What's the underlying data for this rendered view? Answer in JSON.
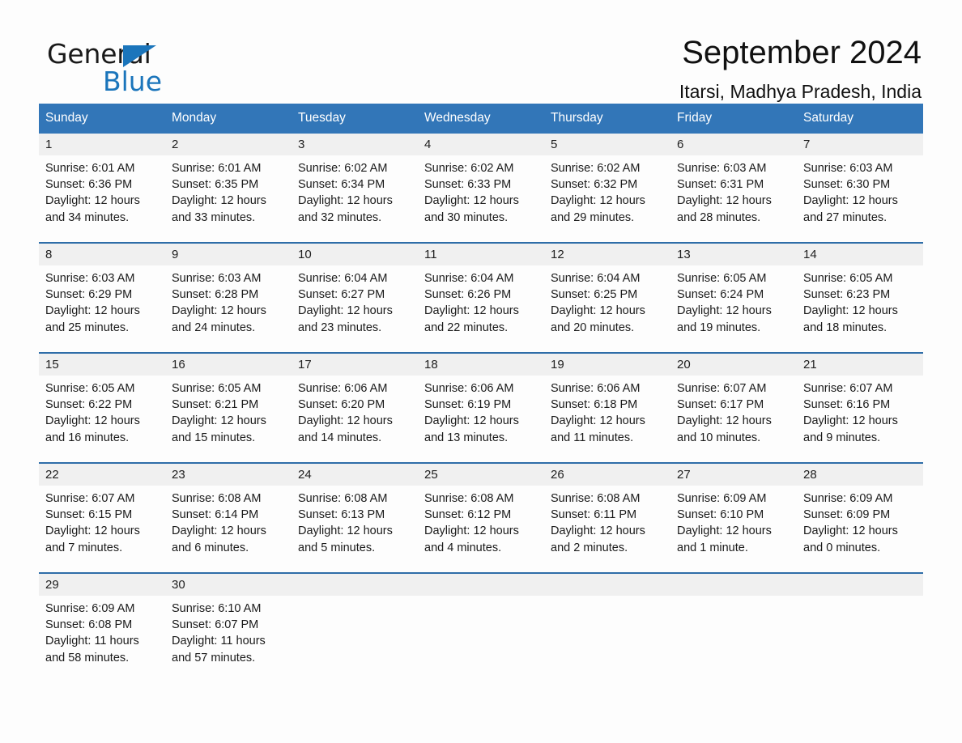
{
  "brand": {
    "word1": "General",
    "word2": "Blue",
    "triangle_color": "#1b75bb"
  },
  "header": {
    "title": "September 2024",
    "subtitle": "Itarsi, Madhya Pradesh, India"
  },
  "theme": {
    "header_blue": "#3276b8",
    "row_rule_blue": "#2e6da8",
    "day_band_gray": "#f0f0f0"
  },
  "weekdays": [
    "Sunday",
    "Monday",
    "Tuesday",
    "Wednesday",
    "Thursday",
    "Friday",
    "Saturday"
  ],
  "weeks": [
    [
      {
        "day": "1",
        "sunrise": "Sunrise: 6:01 AM",
        "sunset": "Sunset: 6:36 PM",
        "daylight1": "Daylight: 12 hours",
        "daylight2": "and 34 minutes."
      },
      {
        "day": "2",
        "sunrise": "Sunrise: 6:01 AM",
        "sunset": "Sunset: 6:35 PM",
        "daylight1": "Daylight: 12 hours",
        "daylight2": "and 33 minutes."
      },
      {
        "day": "3",
        "sunrise": "Sunrise: 6:02 AM",
        "sunset": "Sunset: 6:34 PM",
        "daylight1": "Daylight: 12 hours",
        "daylight2": "and 32 minutes."
      },
      {
        "day": "4",
        "sunrise": "Sunrise: 6:02 AM",
        "sunset": "Sunset: 6:33 PM",
        "daylight1": "Daylight: 12 hours",
        "daylight2": "and 30 minutes."
      },
      {
        "day": "5",
        "sunrise": "Sunrise: 6:02 AM",
        "sunset": "Sunset: 6:32 PM",
        "daylight1": "Daylight: 12 hours",
        "daylight2": "and 29 minutes."
      },
      {
        "day": "6",
        "sunrise": "Sunrise: 6:03 AM",
        "sunset": "Sunset: 6:31 PM",
        "daylight1": "Daylight: 12 hours",
        "daylight2": "and 28 minutes."
      },
      {
        "day": "7",
        "sunrise": "Sunrise: 6:03 AM",
        "sunset": "Sunset: 6:30 PM",
        "daylight1": "Daylight: 12 hours",
        "daylight2": "and 27 minutes."
      }
    ],
    [
      {
        "day": "8",
        "sunrise": "Sunrise: 6:03 AM",
        "sunset": "Sunset: 6:29 PM",
        "daylight1": "Daylight: 12 hours",
        "daylight2": "and 25 minutes."
      },
      {
        "day": "9",
        "sunrise": "Sunrise: 6:03 AM",
        "sunset": "Sunset: 6:28 PM",
        "daylight1": "Daylight: 12 hours",
        "daylight2": "and 24 minutes."
      },
      {
        "day": "10",
        "sunrise": "Sunrise: 6:04 AM",
        "sunset": "Sunset: 6:27 PM",
        "daylight1": "Daylight: 12 hours",
        "daylight2": "and 23 minutes."
      },
      {
        "day": "11",
        "sunrise": "Sunrise: 6:04 AM",
        "sunset": "Sunset: 6:26 PM",
        "daylight1": "Daylight: 12 hours",
        "daylight2": "and 22 minutes."
      },
      {
        "day": "12",
        "sunrise": "Sunrise: 6:04 AM",
        "sunset": "Sunset: 6:25 PM",
        "daylight1": "Daylight: 12 hours",
        "daylight2": "and 20 minutes."
      },
      {
        "day": "13",
        "sunrise": "Sunrise: 6:05 AM",
        "sunset": "Sunset: 6:24 PM",
        "daylight1": "Daylight: 12 hours",
        "daylight2": "and 19 minutes."
      },
      {
        "day": "14",
        "sunrise": "Sunrise: 6:05 AM",
        "sunset": "Sunset: 6:23 PM",
        "daylight1": "Daylight: 12 hours",
        "daylight2": "and 18 minutes."
      }
    ],
    [
      {
        "day": "15",
        "sunrise": "Sunrise: 6:05 AM",
        "sunset": "Sunset: 6:22 PM",
        "daylight1": "Daylight: 12 hours",
        "daylight2": "and 16 minutes."
      },
      {
        "day": "16",
        "sunrise": "Sunrise: 6:05 AM",
        "sunset": "Sunset: 6:21 PM",
        "daylight1": "Daylight: 12 hours",
        "daylight2": "and 15 minutes."
      },
      {
        "day": "17",
        "sunrise": "Sunrise: 6:06 AM",
        "sunset": "Sunset: 6:20 PM",
        "daylight1": "Daylight: 12 hours",
        "daylight2": "and 14 minutes."
      },
      {
        "day": "18",
        "sunrise": "Sunrise: 6:06 AM",
        "sunset": "Sunset: 6:19 PM",
        "daylight1": "Daylight: 12 hours",
        "daylight2": "and 13 minutes."
      },
      {
        "day": "19",
        "sunrise": "Sunrise: 6:06 AM",
        "sunset": "Sunset: 6:18 PM",
        "daylight1": "Daylight: 12 hours",
        "daylight2": "and 11 minutes."
      },
      {
        "day": "20",
        "sunrise": "Sunrise: 6:07 AM",
        "sunset": "Sunset: 6:17 PM",
        "daylight1": "Daylight: 12 hours",
        "daylight2": "and 10 minutes."
      },
      {
        "day": "21",
        "sunrise": "Sunrise: 6:07 AM",
        "sunset": "Sunset: 6:16 PM",
        "daylight1": "Daylight: 12 hours",
        "daylight2": "and 9 minutes."
      }
    ],
    [
      {
        "day": "22",
        "sunrise": "Sunrise: 6:07 AM",
        "sunset": "Sunset: 6:15 PM",
        "daylight1": "Daylight: 12 hours",
        "daylight2": "and 7 minutes."
      },
      {
        "day": "23",
        "sunrise": "Sunrise: 6:08 AM",
        "sunset": "Sunset: 6:14 PM",
        "daylight1": "Daylight: 12 hours",
        "daylight2": "and 6 minutes."
      },
      {
        "day": "24",
        "sunrise": "Sunrise: 6:08 AM",
        "sunset": "Sunset: 6:13 PM",
        "daylight1": "Daylight: 12 hours",
        "daylight2": "and 5 minutes."
      },
      {
        "day": "25",
        "sunrise": "Sunrise: 6:08 AM",
        "sunset": "Sunset: 6:12 PM",
        "daylight1": "Daylight: 12 hours",
        "daylight2": "and 4 minutes."
      },
      {
        "day": "26",
        "sunrise": "Sunrise: 6:08 AM",
        "sunset": "Sunset: 6:11 PM",
        "daylight1": "Daylight: 12 hours",
        "daylight2": "and 2 minutes."
      },
      {
        "day": "27",
        "sunrise": "Sunrise: 6:09 AM",
        "sunset": "Sunset: 6:10 PM",
        "daylight1": "Daylight: 12 hours",
        "daylight2": "and 1 minute."
      },
      {
        "day": "28",
        "sunrise": "Sunrise: 6:09 AM",
        "sunset": "Sunset: 6:09 PM",
        "daylight1": "Daylight: 12 hours",
        "daylight2": "and 0 minutes."
      }
    ],
    [
      {
        "day": "29",
        "sunrise": "Sunrise: 6:09 AM",
        "sunset": "Sunset: 6:08 PM",
        "daylight1": "Daylight: 11 hours",
        "daylight2": "and 58 minutes."
      },
      {
        "day": "30",
        "sunrise": "Sunrise: 6:10 AM",
        "sunset": "Sunset: 6:07 PM",
        "daylight1": "Daylight: 11 hours",
        "daylight2": "and 57 minutes."
      },
      {
        "day": "",
        "sunrise": "",
        "sunset": "",
        "daylight1": "",
        "daylight2": ""
      },
      {
        "day": "",
        "sunrise": "",
        "sunset": "",
        "daylight1": "",
        "daylight2": ""
      },
      {
        "day": "",
        "sunrise": "",
        "sunset": "",
        "daylight1": "",
        "daylight2": ""
      },
      {
        "day": "",
        "sunrise": "",
        "sunset": "",
        "daylight1": "",
        "daylight2": ""
      },
      {
        "day": "",
        "sunrise": "",
        "sunset": "",
        "daylight1": "",
        "daylight2": ""
      }
    ]
  ]
}
